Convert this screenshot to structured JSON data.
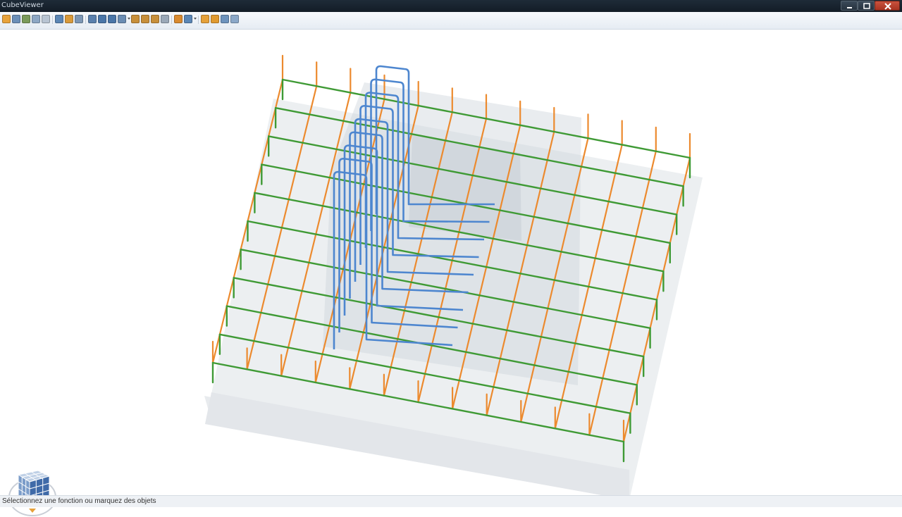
{
  "window": {
    "title": "CubeViewer"
  },
  "toolbar": {
    "buttons": [
      {
        "icon": "save-icon",
        "color": "#e8a33c"
      },
      {
        "icon": "print-icon",
        "color": "#6b8fb8"
      },
      {
        "icon": "print-preview-icon",
        "color": "#7a9a5a"
      },
      {
        "icon": "copy-icon",
        "color": "#8da7c4"
      },
      {
        "icon": "export-icon",
        "color": "#b8c4d2"
      },
      {
        "icon": "select-icon",
        "color": "#5b86b5"
      },
      {
        "icon": "layers-icon",
        "color": "#d99a3a"
      },
      {
        "icon": "properties-icon",
        "color": "#7d97b5"
      },
      {
        "icon": "zoom-extents-icon",
        "color": "#5a80ad"
      },
      {
        "icon": "zoom-in-icon",
        "color": "#4a76a8"
      },
      {
        "icon": "zoom-out-icon",
        "color": "#4a76a8"
      },
      {
        "icon": "pan-icon",
        "color": "#6b8db3"
      },
      {
        "icon": "measure-icon",
        "color": "#c78f3a"
      },
      {
        "icon": "section-icon",
        "color": "#c78f3a"
      },
      {
        "icon": "dimension-icon",
        "color": "#c78f3a"
      },
      {
        "icon": "markup-icon",
        "color": "#9aa8b8"
      },
      {
        "icon": "render-icon",
        "color": "#d98a2f"
      },
      {
        "icon": "view-mode-icon",
        "color": "#5b86b5"
      },
      {
        "icon": "cube-icon",
        "color": "#e5a13a"
      },
      {
        "icon": "shade-icon",
        "color": "#e09a30"
      },
      {
        "icon": "wireframe-icon",
        "color": "#6d93bd"
      },
      {
        "icon": "transparent-icon",
        "color": "#8ba8c8"
      }
    ]
  },
  "status": {
    "text": "Sélectionnez une fonction ou marquez des objets"
  },
  "colors": {
    "slab": "#dfe3e8",
    "rebar_x": "#3f9a35",
    "rebar_y": "#ec8a2e",
    "stirrup": "#4d86cf"
  }
}
